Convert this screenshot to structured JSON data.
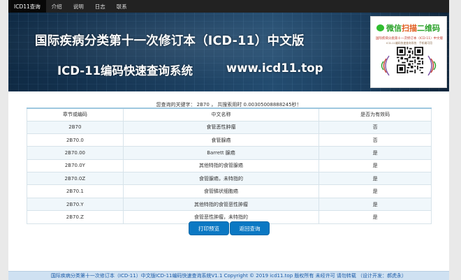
{
  "nav": {
    "brand": "ICD11查询",
    "items": [
      "介绍",
      "说明",
      "日志",
      "联系"
    ]
  },
  "banner": {
    "title": "国际疾病分类第十一次修订本（ICD-11）中文版",
    "subtitle": "ICD-11编码快速查询系统",
    "url": "www.icd11.top",
    "qr": {
      "prefix": "微信",
      "highlight": "扫描",
      "suffix": "二维码",
      "line1": "国际疾病分类第十一次修订本（ICD-11）中文版",
      "line2": "ICD-11编码快速查询系统 · 手机端可用"
    }
  },
  "query_info": "您查询的关键字：  2B70 ，  共搜索用时 0.00305008888245秒！",
  "table": {
    "headers": [
      "章节或编码",
      "中文名称",
      "是否为有效码"
    ],
    "rows": [
      [
        "2B70",
        "食管恶性肿瘤",
        "否"
      ],
      [
        "2B70.0",
        "食管腺癌",
        "否"
      ],
      [
        "2B70.00",
        "Barrett 腺癌",
        "是"
      ],
      [
        "2B70.0Y",
        "其他特指的食管腺癌",
        "是"
      ],
      [
        "2B70.0Z",
        "食管腺癌，未特指的",
        "是"
      ],
      [
        "2B70.1",
        "食管鳞状细胞癌",
        "是"
      ],
      [
        "2B70.Y",
        "其他特指的食管恶性肿瘤",
        "是"
      ],
      [
        "2B70.Z",
        "食管恶性肿瘤，未特指的",
        "是"
      ]
    ]
  },
  "buttons": {
    "print": "打印预览",
    "back": "返回查询"
  },
  "footer": "国际疾病分类第十一次修订本（ICD-11）中文版ICD-11编码快速查询系统V1.1 Copyright © 2019 icd11.top 版权所有 未经许可 请勿转载  （设计开发：郝虎永）",
  "colors": {
    "nav_bg": "#222222",
    "button": "#0b78c3",
    "table_accent": "#9ec7df",
    "footer_bg": "#cfe1f2"
  }
}
